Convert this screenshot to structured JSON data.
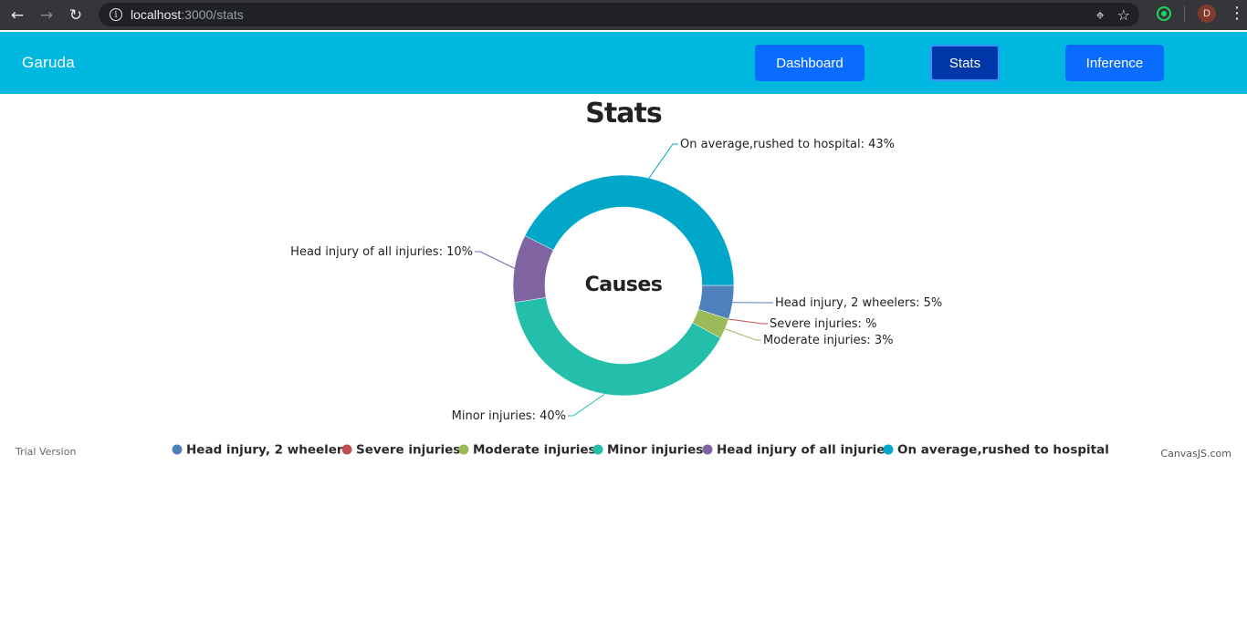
{
  "browser": {
    "url_host": "localhost",
    "url_path": ":3000/stats",
    "avatar_letter": "D",
    "back_icon": "←",
    "forward_icon": "→",
    "reload_icon": "↻",
    "location_icon": "⌖",
    "star_icon": "☆",
    "menu_icon": "⋮"
  },
  "app": {
    "brand": "Garuda",
    "nav": [
      {
        "label": "Dashboard",
        "active": false
      },
      {
        "label": "Stats",
        "active": true
      },
      {
        "label": "Inference",
        "active": false
      }
    ],
    "header_color": "#00b7df",
    "button_color": "#0a6cff",
    "active_button_color": "#0037a8"
  },
  "chart_data": {
    "type": "pie",
    "style": "doughnut",
    "title": "Stats",
    "center_label": "Causes",
    "series": [
      {
        "name": "Head injury, 2 wheelers",
        "value": 5,
        "label": "Head injury, 2 wheelers: 5%",
        "color": "#4f81bc"
      },
      {
        "name": "Severe injuries",
        "value": null,
        "label": "Severe injuries: %",
        "color": "#c0504e"
      },
      {
        "name": "Moderate injuries",
        "value": 3,
        "label": "Moderate injuries: 3%",
        "color": "#9bbb58"
      },
      {
        "name": "Minor injuries",
        "value": 40,
        "label": "Minor injuries: 40%",
        "color": "#23bfaa"
      },
      {
        "name": "Head injury of all injuries",
        "value": 10,
        "label": "Head injury of all injuries: 10%",
        "color": "#8064a1"
      },
      {
        "name": "On average,rushed to hospital",
        "value": 43,
        "label": "On average,rushed to hospital: 43%",
        "color": "#00a7c8"
      }
    ],
    "legend_position": "bottom",
    "watermark_left": "Trial Version",
    "watermark_right": "CanvasJS.com"
  }
}
